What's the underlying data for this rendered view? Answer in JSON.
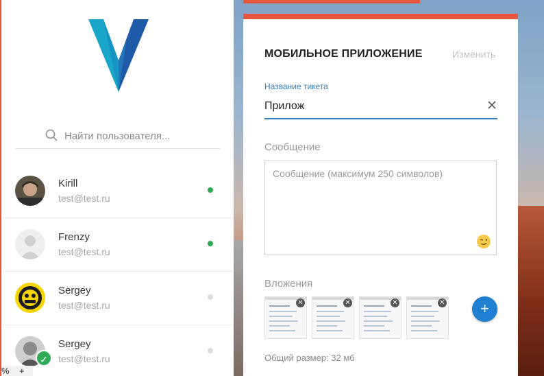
{
  "search": {
    "placeholder": "Найти пользователя..."
  },
  "users": [
    {
      "name": "Kirill",
      "email": "test@test.ru",
      "online": true
    },
    {
      "name": "Frenzy",
      "email": "test@test.ru",
      "online": true
    },
    {
      "name": "Sergey",
      "email": "test@test.ru",
      "online": false
    },
    {
      "name": "Sergey",
      "email": "test@test.ru",
      "online": false
    }
  ],
  "bottom_bar": {
    "left": "%",
    "plus": "+"
  },
  "modal": {
    "title": "МОБИЛЬНОЕ ПРИЛОЖЕНИЕ",
    "edit_label": "Изменить",
    "ticket_label": "Название тикета",
    "ticket_value": "Прилож",
    "message_label": "Сообщение",
    "message_placeholder": "Сообщение (максимум 250 символов)",
    "attachments_label": "Вложения",
    "add_label": "+",
    "total_size": "Общий размер: 32 мб"
  },
  "colors": {
    "accent": "#e8563f",
    "primary": "#2c7fbf",
    "online": "#2fa857",
    "offline": "#d5d5d5"
  },
  "icons": [
    "logo",
    "search-icon",
    "clear-icon",
    "emoji-icon",
    "remove-icon",
    "check-icon"
  ]
}
